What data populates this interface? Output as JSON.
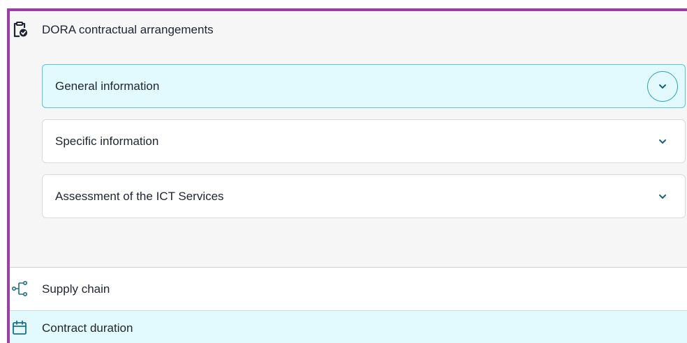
{
  "dora_section": {
    "title": "DORA contractual arrangements",
    "icon": "clipboard-check-icon",
    "expanded": true,
    "accordions": [
      {
        "label": "General information",
        "active": true
      },
      {
        "label": "Specific information",
        "active": false
      },
      {
        "label": "Assessment of the ICT Services",
        "active": false
      }
    ]
  },
  "sections": [
    {
      "label": "Supply chain",
      "icon": "supply-chain-icon"
    },
    {
      "label": "Contract duration",
      "icon": "calendar-icon"
    }
  ],
  "colors": {
    "focus_frame": "#9b3fa5",
    "active_background": "#e2fafd",
    "active_border": "#5bc4d6",
    "icon_teal": "#1e6e86",
    "chevron": "#1c5f7a"
  }
}
